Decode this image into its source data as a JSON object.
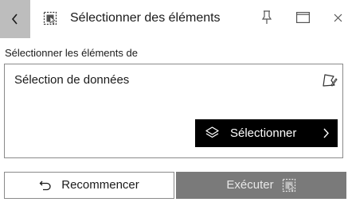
{
  "header": {
    "title": "Sélectionner des éléments",
    "icons": {
      "back": "chevron-left-icon",
      "tool": "select-features-icon",
      "pin": "pin-icon",
      "dock": "window-icon",
      "close": "close-icon"
    }
  },
  "section": {
    "label": "Sélectionner les éléments de"
  },
  "panel": {
    "title": "Sélection de données",
    "draw_icon": "draw-polygon-icon",
    "select_button": {
      "label": "Sélectionner",
      "icon": "layers-icon",
      "chevron": "chevron-right-icon"
    }
  },
  "footer": {
    "reset_label": "Recommencer",
    "run_label": "Exécuter"
  },
  "colors": {
    "back_bg": "#bdbdbd",
    "select_bg": "#000000",
    "run_bg": "#7a7a7a",
    "border": "#8a8a8a"
  }
}
